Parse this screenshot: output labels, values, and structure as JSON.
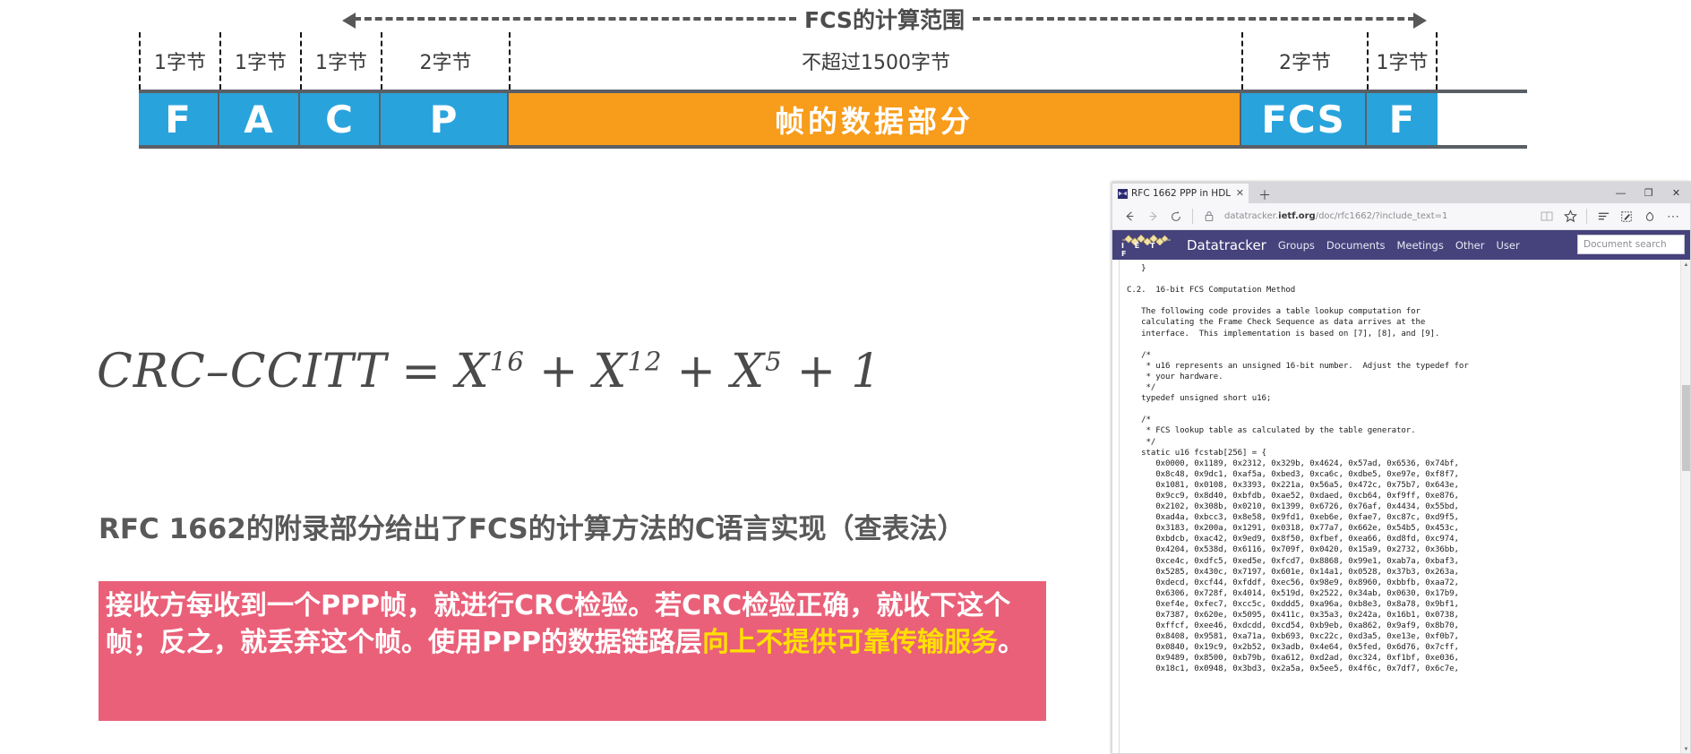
{
  "diagram": {
    "scope_label": "FCS的计算范围",
    "size_labels": [
      "1字节",
      "1字节",
      "1字节",
      "2字节",
      "不超过1500字节",
      "2字节",
      "1字节"
    ],
    "fields": [
      {
        "label": "F",
        "kind": "latin",
        "color": "#29a3dc"
      },
      {
        "label": "A",
        "kind": "latin",
        "color": "#29a3dc"
      },
      {
        "label": "C",
        "kind": "latin",
        "color": "#29a3dc"
      },
      {
        "label": "P",
        "kind": "latin",
        "color": "#29a3dc"
      },
      {
        "label": "帧的数据部分",
        "kind": "cjk",
        "color": "#f89c1c"
      },
      {
        "label": "FCS",
        "kind": "latin",
        "color": "#29a3dc"
      },
      {
        "label": "F",
        "kind": "latin",
        "color": "#29a3dc"
      }
    ],
    "colors": {
      "blue": "#29a3dc",
      "orange": "#f89c1c",
      "outline": "#5a5f66",
      "dash": "#585858"
    }
  },
  "formula": {
    "lhs": "CRC–CCITT",
    "equals": "=",
    "terms": [
      {
        "base": "X",
        "exp": "16"
      },
      {
        "base": "X",
        "exp": "12"
      },
      {
        "base": "X",
        "exp": "5"
      },
      {
        "base": "1",
        "exp": ""
      }
    ],
    "plus": "+"
  },
  "rfc_headline": "RFC 1662的附录部分给出了FCS的计算方法的C语言实现（查表法）",
  "callout": {
    "bg": "#ea6079",
    "highlight_color": "#ffe000",
    "segments": [
      {
        "text": "接收方每收到一个PPP帧，就进行CRC检验。若CRC检验正确，就收下这个帧；反之，就丢弃这个帧。使用PPP的数据链路层",
        "highlight": false
      },
      {
        "text": "向上不提供可靠传输服务",
        "highlight": true
      },
      {
        "text": "。",
        "highlight": false
      }
    ]
  },
  "browser": {
    "tab": {
      "title": "RFC 1662  PPP in HDLC",
      "close_glyph": "✕",
      "favicon": "ietf-favicon"
    },
    "newtab_glyph": "＋",
    "window_buttons": [
      {
        "name": "minimize",
        "glyph": "—"
      },
      {
        "name": "maximize",
        "glyph": "❐"
      },
      {
        "name": "close",
        "glyph": "✕"
      }
    ],
    "toolbar": {
      "back_glyph": "←",
      "forward_glyph": "→",
      "refresh_glyph": "↻",
      "lock_glyph": "🔒",
      "url_prefix": "datatracker.",
      "url_domain": "ietf.org",
      "url_suffix": "/doc/rfc1662/?include_text=1",
      "reading_view_glyph": "▯",
      "favorite_glyph": "☆",
      "hub_glyph": "≡",
      "notes_glyph": "✎",
      "share_glyph": "◌",
      "more_glyph": "⋯"
    },
    "ietf_nav": {
      "logo_letters": "I E T F",
      "brand": "Datatracker",
      "items": [
        "Groups",
        "Documents",
        "Meetings",
        "Other",
        "User"
      ],
      "search_placeholder": "Document search",
      "bg": "#46427c"
    },
    "document": {
      "lines": [
        "   }",
        "",
        "C.2.  16-bit FCS Computation Method",
        "",
        "   The following code provides a table lookup computation for",
        "   calculating the Frame Check Sequence as data arrives at the",
        "   interface.  This implementation is based on [7], [8], and [9].",
        "",
        "   /*",
        "    * u16 represents an unsigned 16-bit number.  Adjust the typedef for",
        "    * your hardware.",
        "    */",
        "   typedef unsigned short u16;",
        "",
        "   /*",
        "    * FCS lookup table as calculated by the table generator.",
        "    */",
        "   static u16 fcstab[256] = {",
        "      0x0000, 0x1189, 0x2312, 0x329b, 0x4624, 0x57ad, 0x6536, 0x74bf,",
        "      0x8c48, 0x9dc1, 0xaf5a, 0xbed3, 0xca6c, 0xdbe5, 0xe97e, 0xf8f7,",
        "      0x1081, 0x0108, 0x3393, 0x221a, 0x56a5, 0x472c, 0x75b7, 0x643e,",
        "      0x9cc9, 0x8d40, 0xbfdb, 0xae52, 0xdaed, 0xcb64, 0xf9ff, 0xe876,",
        "      0x2102, 0x308b, 0x0210, 0x1399, 0x6726, 0x76af, 0x4434, 0x55bd,",
        "      0xad4a, 0xbcc3, 0x8e58, 0x9fd1, 0xeb6e, 0xfae7, 0xc87c, 0xd9f5,",
        "      0x3183, 0x200a, 0x1291, 0x0318, 0x77a7, 0x662e, 0x54b5, 0x453c,",
        "      0xbdcb, 0xac42, 0x9ed9, 0x8f50, 0xfbef, 0xea66, 0xd8fd, 0xc974,",
        "      0x4204, 0x538d, 0x6116, 0x709f, 0x0420, 0x15a9, 0x2732, 0x36bb,",
        "      0xce4c, 0xdfc5, 0xed5e, 0xfcd7, 0x8868, 0x99e1, 0xab7a, 0xbaf3,",
        "      0x5285, 0x430c, 0x7197, 0x601e, 0x14a1, 0x0528, 0x37b3, 0x263a,",
        "      0xdecd, 0xcf44, 0xfddf, 0xec56, 0x98e9, 0x8960, 0xbbfb, 0xaa72,",
        "      0x6306, 0x728f, 0x4014, 0x519d, 0x2522, 0x34ab, 0x0630, 0x17b9,",
        "      0xef4e, 0xfec7, 0xcc5c, 0xddd5, 0xa96a, 0xb8e3, 0x8a78, 0x9bf1,",
        "      0x7387, 0x620e, 0x5095, 0x411c, 0x35a3, 0x242a, 0x16b1, 0x0738,",
        "      0xffcf, 0xee46, 0xdcdd, 0xcd54, 0xb9eb, 0xa862, 0x9af9, 0x8b70,",
        "      0x8408, 0x9581, 0xa71a, 0xb693, 0xc22c, 0xd3a5, 0xe13e, 0xf0b7,",
        "      0x0840, 0x19c9, 0x2b52, 0x3adb, 0x4e64, 0x5fed, 0x6d76, 0x7cff,",
        "      0x9489, 0x8500, 0xb79b, 0xa612, 0xd2ad, 0xc324, 0xf1bf, 0xe036,",
        "      0x18c1, 0x0948, 0x3bd3, 0x2a5a, 0x5ee5, 0x4f6c, 0x7df7, 0x6c7e,"
      ]
    }
  }
}
